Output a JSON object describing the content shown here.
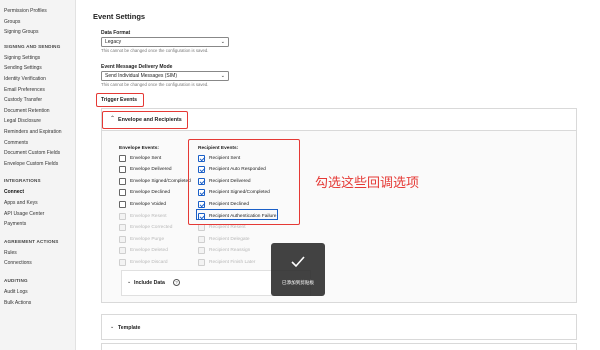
{
  "sidebar": {
    "items_top": [
      "Permission Profiles",
      "Groups",
      "Signing Groups"
    ],
    "signing_heading": "SIGNING AND SENDING",
    "signing_items": [
      "Signing Settings",
      "Sending Settings",
      "Identity Verification",
      "Email Preferences",
      "Custody Transfer",
      "Document Retention",
      "Legal Disclosure",
      "Reminders and Expiration",
      "Comments",
      "Document Custom Fields",
      "Envelope Custom Fields"
    ],
    "integrations_heading": "INTEGRATIONS",
    "integrations_items": [
      "Connect",
      "Apps and Keys",
      "API Usage Center",
      "Payments"
    ],
    "agreement_heading": "AGREEMENT ACTIONS",
    "agreement_items": [
      "Rules",
      "Connections"
    ],
    "auditing_heading": "AUDITING",
    "auditing_items": [
      "Audit Logs",
      "Bulk Actions"
    ],
    "active_item": "Connect"
  },
  "main": {
    "title": "Event Settings",
    "data_format": {
      "label": "Data Format",
      "value": "Legacy",
      "hint": "This cannot be changed once the configuration is saved."
    },
    "delivery_mode": {
      "label": "Event Message Delivery Mode",
      "value": "Send Individual Messages (SIM)",
      "hint": "This cannot be changed once the configuration is saved."
    },
    "trigger_events_label": "Trigger Events",
    "panel_label": "Envelope and Recipients",
    "envelope_events_title": "Envelope Events:",
    "recipient_events_title": "Recipient Events:",
    "envelope_events": [
      {
        "label": "Envelope Sent",
        "checked": false,
        "disabled": false
      },
      {
        "label": "Envelope Delivered",
        "checked": false,
        "disabled": false
      },
      {
        "label": "Envelope Signed/Completed",
        "checked": false,
        "disabled": false
      },
      {
        "label": "Envelope Declined",
        "checked": false,
        "disabled": false
      },
      {
        "label": "Envelope Voided",
        "checked": false,
        "disabled": false
      },
      {
        "label": "Envelope Resent",
        "checked": false,
        "disabled": true
      },
      {
        "label": "Envelope Corrected",
        "checked": false,
        "disabled": true
      },
      {
        "label": "Envelope Purge",
        "checked": false,
        "disabled": true
      },
      {
        "label": "Envelope Deleted",
        "checked": false,
        "disabled": true
      },
      {
        "label": "Envelope Discard",
        "checked": false,
        "disabled": true
      }
    ],
    "recipient_events": [
      {
        "label": "Recipient Sent",
        "checked": true,
        "disabled": false
      },
      {
        "label": "Recipient Auto Responded",
        "checked": true,
        "disabled": false
      },
      {
        "label": "Recipient Delivered",
        "checked": true,
        "disabled": false
      },
      {
        "label": "Recipient Signed/Completed",
        "checked": true,
        "disabled": false
      },
      {
        "label": "Recipient Declined",
        "checked": true,
        "disabled": false
      },
      {
        "label": "Recipient Authentication Failure",
        "checked": true,
        "disabled": false
      },
      {
        "label": "Recipient Resent",
        "checked": false,
        "disabled": true
      },
      {
        "label": "Recipient Delegate",
        "checked": false,
        "disabled": true
      },
      {
        "label": "Recipient Reassign",
        "checked": false,
        "disabled": true
      },
      {
        "label": "Recipient Finish Later",
        "checked": false,
        "disabled": true
      }
    ],
    "annotation": "勾选这些回调选项",
    "include_data_label": "Include Data",
    "include_help_glyph": "?",
    "template_label": "Template",
    "caret_glyph": "⌃",
    "caret_down_glyph": "⌄"
  },
  "toast": {
    "text": "已添加到剪贴板"
  },
  "colors": {
    "highlight": "#e53935",
    "checkbox": "#1a5fc7"
  }
}
